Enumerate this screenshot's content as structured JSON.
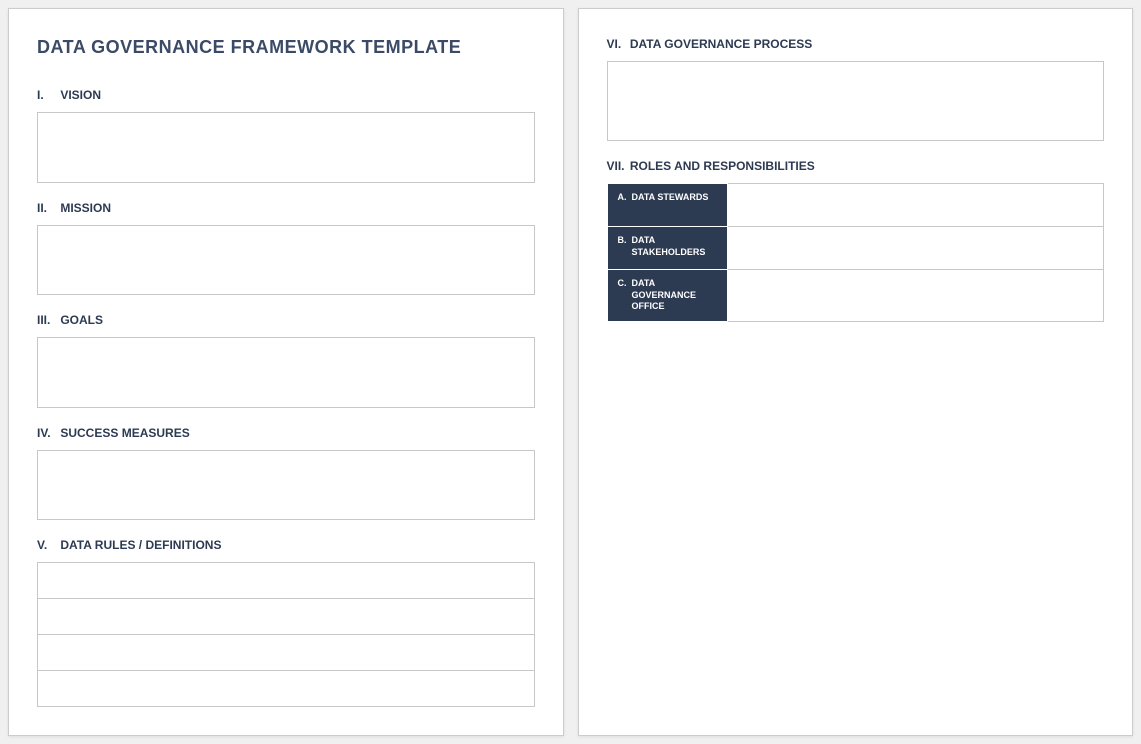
{
  "title": "DATA GOVERNANCE FRAMEWORK TEMPLATE",
  "left": {
    "s1": {
      "num": "I.",
      "label": "VISION"
    },
    "s2": {
      "num": "II.",
      "label": "MISSION"
    },
    "s3": {
      "num": "III.",
      "label": "GOALS"
    },
    "s4": {
      "num": "IV.",
      "label": "SUCCESS MEASURES"
    },
    "s5": {
      "num": "V.",
      "label": "DATA RULES / DEFINITIONS"
    }
  },
  "right": {
    "s6": {
      "num": "VI.",
      "label": "DATA GOVERNANCE PROCESS"
    },
    "s7": {
      "num": "VII.",
      "label": "ROLES AND RESPONSIBILITIES",
      "rows": {
        "a": {
          "letter": "A.",
          "label": "DATA STEWARDS"
        },
        "b": {
          "letter": "B.",
          "label": "DATA STAKEHOLDERS"
        },
        "c": {
          "letter": "C.",
          "label": "DATA GOVERNANCE OFFICE"
        }
      }
    }
  }
}
